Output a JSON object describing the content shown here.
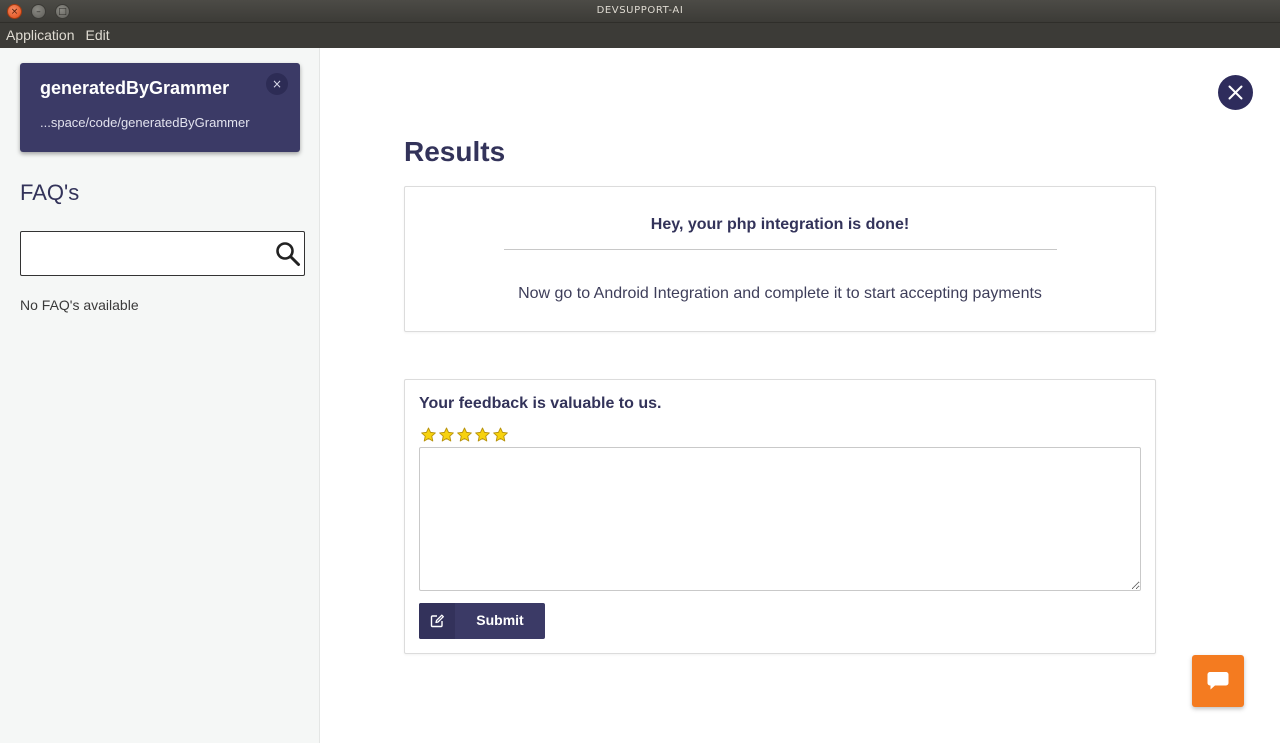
{
  "window": {
    "title": "DEVSUPPORT-AI",
    "close_glyph": "×",
    "minimize_glyph": "–",
    "maximize_glyph": "□"
  },
  "menubar": {
    "items": [
      "Application",
      "Edit"
    ]
  },
  "sidebar": {
    "project": {
      "name": "generatedByGrammer",
      "path": "...space/code/generatedByGrammer",
      "close_glyph": "×"
    },
    "faq": {
      "title": "FAQ's",
      "search_value": "",
      "empty_text": "No FAQ's available"
    }
  },
  "main": {
    "title": "Results",
    "result": {
      "heading": "Hey, your php integration is done!",
      "message": "Now go to Android Integration and complete it to start accepting payments"
    },
    "feedback": {
      "title": "Your feedback is valuable to us.",
      "rating_max": 5,
      "rating_value": 5,
      "comment_value": "",
      "submit_label": "Submit"
    }
  },
  "icons": {
    "close": "close-icon",
    "search": "search-icon",
    "star": "star-icon",
    "edit": "edit-icon",
    "chat": "chat-icon"
  },
  "colors": {
    "brand": "#3b3a66",
    "chat_button": "#f47b20",
    "star": "#f7d20e"
  }
}
